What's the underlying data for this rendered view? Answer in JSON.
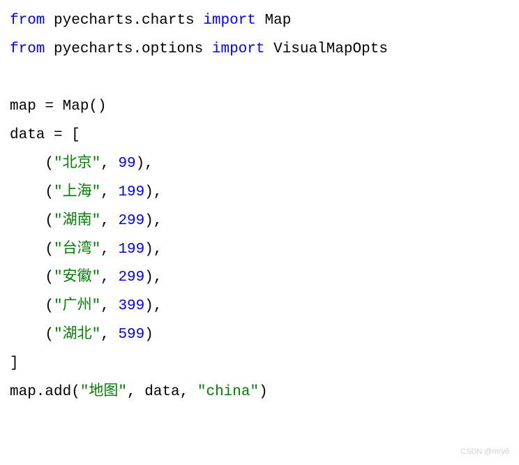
{
  "code": {
    "line1": {
      "kw_from": "from",
      "module1": " pyecharts.charts ",
      "kw_import": "import",
      "item1": " Map"
    },
    "line2": {
      "kw_from": "from",
      "module2": " pyecharts.options ",
      "kw_import": "import",
      "item2": " VisualMapOpts"
    },
    "line4": "map = Map()",
    "line5": "data = [",
    "line6": {
      "indent": "    (",
      "s": "\"北京\"",
      "sep": ", ",
      "n": "99",
      "end": "),"
    },
    "line7": {
      "indent": "    (",
      "s": "\"上海\"",
      "sep": ", ",
      "n": "199",
      "end": "),"
    },
    "line8": {
      "indent": "    (",
      "s": "\"湖南\"",
      "sep": ", ",
      "n": "299",
      "end": "),"
    },
    "line9": {
      "indent": "    (",
      "s": "\"台湾\"",
      "sep": ", ",
      "n": "199",
      "end": "),"
    },
    "line10": {
      "indent": "    (",
      "s": "\"安徽\"",
      "sep": ", ",
      "n": "299",
      "end": "),"
    },
    "line11": {
      "indent": "    (",
      "s": "\"广州\"",
      "sep": ", ",
      "n": "399",
      "end": "),"
    },
    "line12": {
      "indent": "    (",
      "s": "\"湖北\"",
      "sep": ", ",
      "n": "599",
      "end": ")"
    },
    "line13": "]",
    "line14": {
      "pre": "map.add(",
      "s1": "\"地图\"",
      "sep1": ", data, ",
      "s2": "\"china\"",
      "end": ")"
    }
  },
  "watermark": "CSDN @mry6"
}
